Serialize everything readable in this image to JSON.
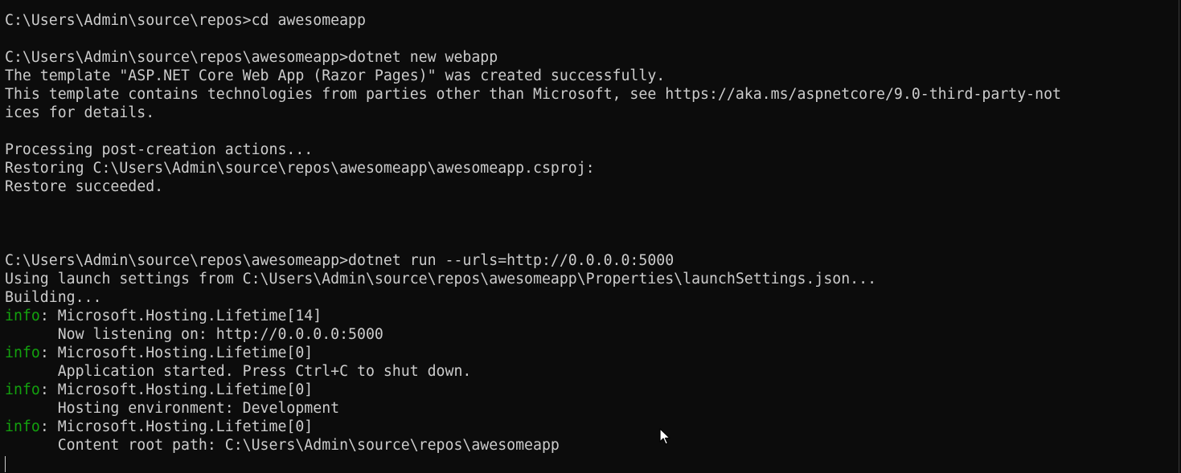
{
  "terminal": {
    "lines": [
      {
        "prefix": "",
        "text": "C:\\Users\\Admin\\source\\repos>cd awesomeapp"
      },
      {
        "prefix": "",
        "text": ""
      },
      {
        "prefix": "",
        "text": "C:\\Users\\Admin\\source\\repos\\awesomeapp>dotnet new webapp"
      },
      {
        "prefix": "",
        "text": "The template \"ASP.NET Core Web App (Razor Pages)\" was created successfully."
      },
      {
        "prefix": "",
        "text": "This template contains technologies from parties other than Microsoft, see https://aka.ms/aspnetcore/9.0-third-party-not"
      },
      {
        "prefix": "",
        "text": "ices for details."
      },
      {
        "prefix": "",
        "text": ""
      },
      {
        "prefix": "",
        "text": "Processing post-creation actions..."
      },
      {
        "prefix": "",
        "text": "Restoring C:\\Users\\Admin\\source\\repos\\awesomeapp\\awesomeapp.csproj:"
      },
      {
        "prefix": "",
        "text": "Restore succeeded."
      },
      {
        "prefix": "",
        "text": ""
      },
      {
        "prefix": "",
        "text": ""
      },
      {
        "prefix": "",
        "text": ""
      },
      {
        "prefix": "",
        "text": "C:\\Users\\Admin\\source\\repos\\awesomeapp>dotnet run --urls=http://0.0.0.0:5000"
      },
      {
        "prefix": "",
        "text": "Using launch settings from C:\\Users\\Admin\\source\\repos\\awesomeapp\\Properties\\launchSettings.json..."
      },
      {
        "prefix": "",
        "text": "Building..."
      },
      {
        "prefix": "info",
        "text": ": Microsoft.Hosting.Lifetime[14]"
      },
      {
        "prefix": "",
        "text": "      Now listening on: http://0.0.0.0:5000"
      },
      {
        "prefix": "info",
        "text": ": Microsoft.Hosting.Lifetime[0]"
      },
      {
        "prefix": "",
        "text": "      Application started. Press Ctrl+C to shut down."
      },
      {
        "prefix": "info",
        "text": ": Microsoft.Hosting.Lifetime[0]"
      },
      {
        "prefix": "",
        "text": "      Hosting environment: Development"
      },
      {
        "prefix": "info",
        "text": ": Microsoft.Hosting.Lifetime[0]"
      },
      {
        "prefix": "",
        "text": "      Content root path: C:\\Users\\Admin\\source\\repos\\awesomeapp"
      }
    ]
  },
  "colors": {
    "background": "#0c0c0c",
    "foreground": "#cccccc",
    "info_prefix": "#13a10e"
  },
  "icons": {
    "pointer": "mouse-pointer-icon",
    "cursor": "text-cursor"
  }
}
